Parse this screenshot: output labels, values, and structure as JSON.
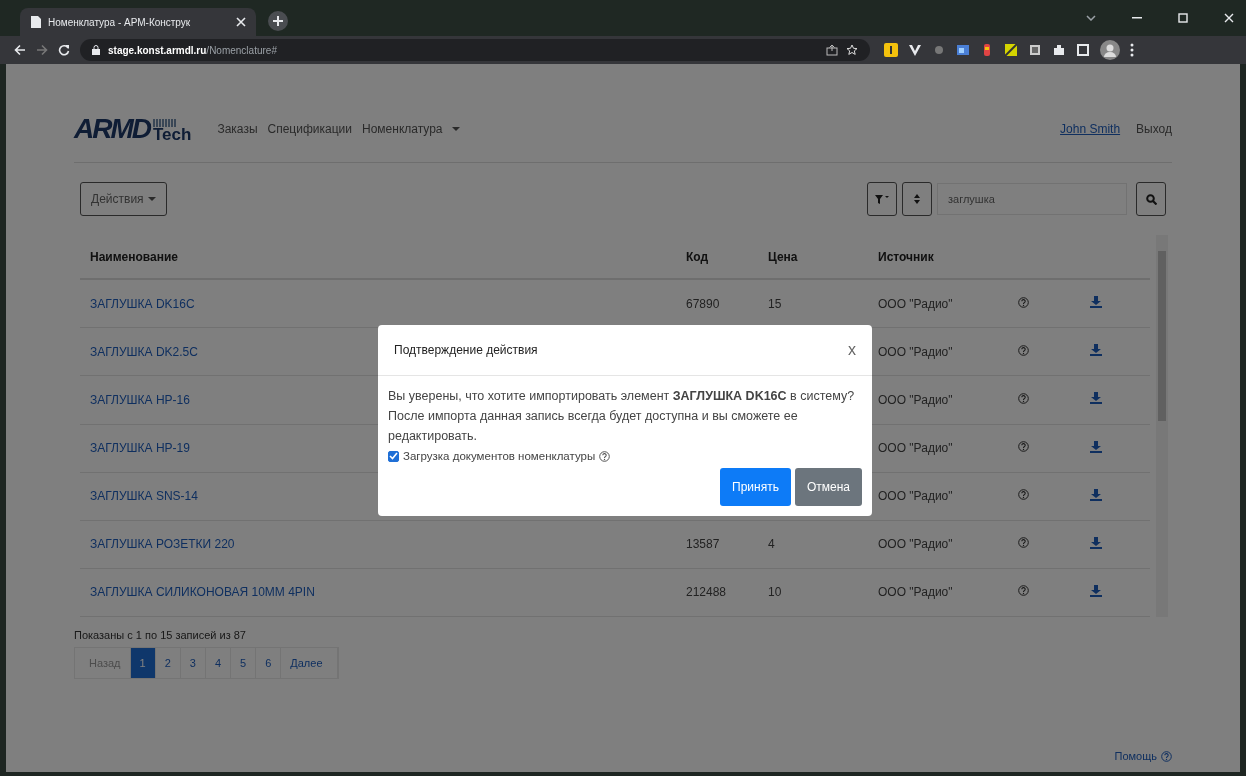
{
  "browser": {
    "tab_title": "Номенклатура - АРМ-Конструк",
    "address_host": "stage.konst.armdl.ru",
    "address_path": "/Nomenclature#"
  },
  "header": {
    "logo_main": "ARMD",
    "logo_sub": "Tech",
    "nav": [
      {
        "label": "Заказы",
        "dropdown": false
      },
      {
        "label": "Спецификации",
        "dropdown": false
      },
      {
        "label": "Номенклатура",
        "dropdown": true
      }
    ],
    "user": "John Smith",
    "logout": "Выход"
  },
  "toolbar": {
    "actions": "Действия",
    "search_value": "заглушка"
  },
  "table": {
    "columns": [
      "Наименование",
      "Код",
      "Цена",
      "Источник"
    ],
    "rows": [
      {
        "name": "ЗАГЛУШКА DK16C",
        "code": "67890",
        "price": "15",
        "source": "ООО \"Радио\""
      },
      {
        "name": "ЗАГЛУШКА DK2.5C",
        "source": "ООО \"Радио\""
      },
      {
        "name": "ЗАГЛУШКА HP-16",
        "source": "ООО \"Радио\""
      },
      {
        "name": "ЗАГЛУШКА HP-19",
        "source": "ООО \"Радио\""
      },
      {
        "name": "ЗАГЛУШКА SNS-14",
        "source": "ООО \"Радио\""
      },
      {
        "name": "ЗАГЛУШКА РОЗЕТКИ 220",
        "code": "13587",
        "price": "4",
        "source": "ООО \"Радио\""
      },
      {
        "name": "ЗАГЛУШКА СИЛИКОНОВАЯ 10ММ 4PIN",
        "code": "212488",
        "price": "10",
        "source": "ООО \"Радио\""
      }
    ]
  },
  "footer": {
    "summary": "Показаны с 1 по 15 записей из 87",
    "pagination": [
      {
        "label": "Назад",
        "kind": "prev",
        "disabled": true,
        "selected": false
      },
      {
        "label": "1",
        "kind": "page",
        "disabled": false,
        "selected": true
      },
      {
        "label": "2",
        "kind": "page",
        "disabled": false,
        "selected": false
      },
      {
        "label": "3",
        "kind": "page",
        "disabled": false,
        "selected": false
      },
      {
        "label": "4",
        "kind": "page",
        "disabled": false,
        "selected": false
      },
      {
        "label": "5",
        "kind": "page",
        "disabled": false,
        "selected": false
      },
      {
        "label": "6",
        "kind": "page",
        "disabled": false,
        "selected": false
      },
      {
        "label": "Далее",
        "kind": "next",
        "disabled": false,
        "selected": false
      }
    ],
    "help": "Помощь"
  },
  "modal": {
    "title": "Подтверждение действия",
    "close": "x",
    "message": "Вы уверены, что хотите импортировать элемент **ЗАГЛУШКА DK16C** в систему? После импорта данная запись всегда будет доступна и вы сможете ее редактировать.",
    "checkbox": {
      "label": "Загрузка документов номенклатуры",
      "checked": true
    },
    "buttons": [
      {
        "label": "Принять",
        "kind": "primary"
      },
      {
        "label": "Отмена",
        "kind": "secondary"
      }
    ]
  }
}
